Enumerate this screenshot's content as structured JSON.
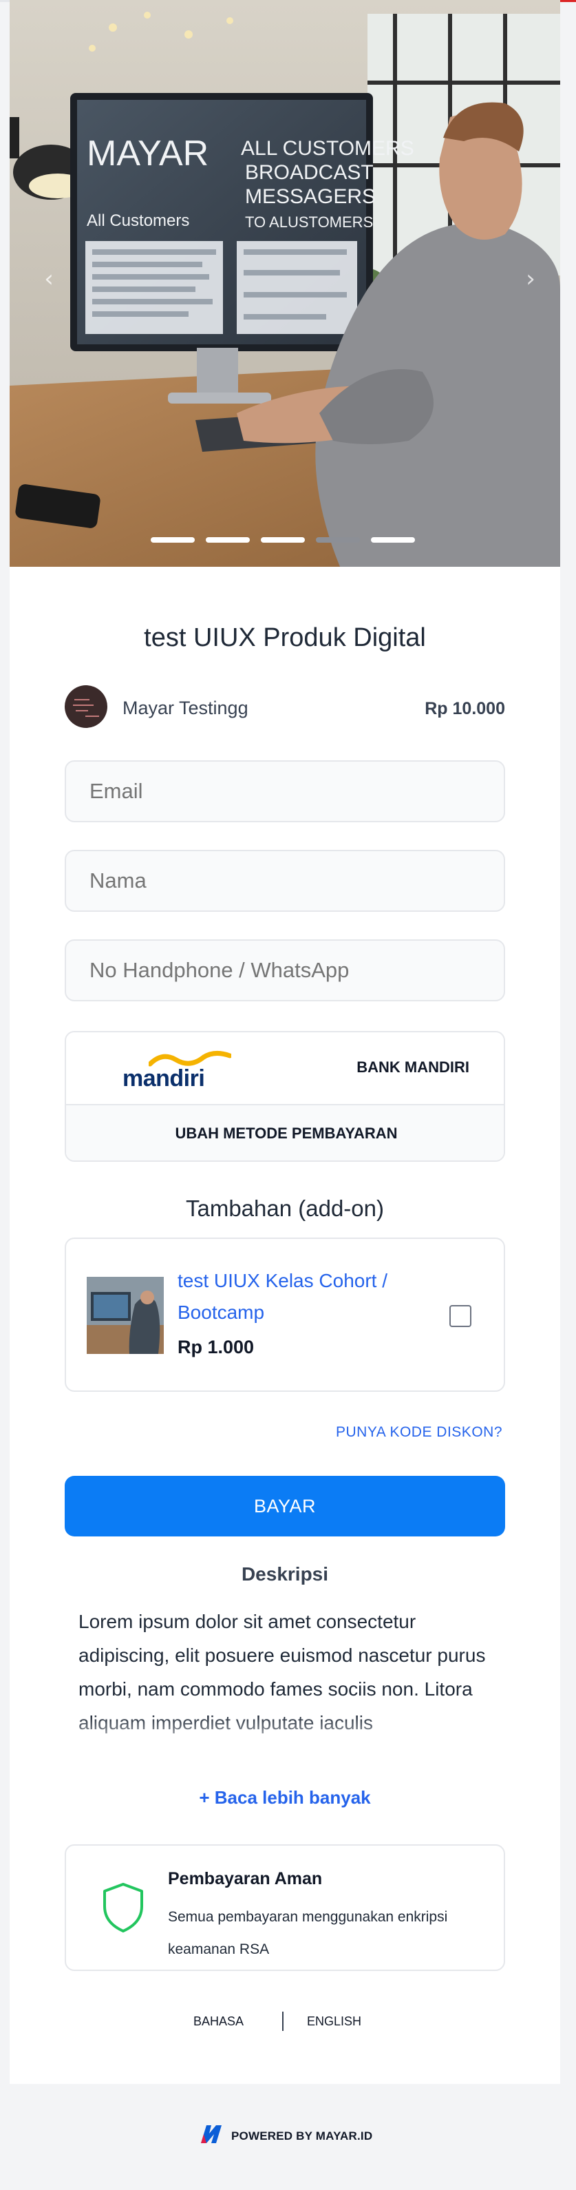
{
  "hero": {
    "monitor_brand": "MAYAR",
    "monitor_left_text": "All Customers",
    "monitor_right_text": [
      "ALL CUSTOMERS",
      "BROADCAST",
      "MESSAGERS",
      "TO ALUSTOMERS"
    ],
    "slides": 5,
    "active_slide": 4
  },
  "product": {
    "title": "test UIUX Produk Digital",
    "seller": "Mayar Testingg",
    "price": "Rp 10.000"
  },
  "form": {
    "email_placeholder": "Email",
    "name_placeholder": "Nama",
    "phone_placeholder": "No Handphone / WhatsApp"
  },
  "payment": {
    "bank_logo_text": "mandiri",
    "bank_name": "BANK MANDIRI",
    "change_label": "UBAH METODE PEMBAYARAN"
  },
  "addon": {
    "section_title": "Tambahan (add-on)",
    "name": "test UIUX Kelas Cohort / Bootcamp",
    "price": "Rp 1.000",
    "checked": false
  },
  "discount_link": "PUNYA KODE DISKON?",
  "pay_button": "BAYAR",
  "description": {
    "title": "Deskripsi",
    "body": "Lorem ipsum dolor sit amet consectetur adipiscing, elit posuere euismod nascetur purus morbi, nam commodo fames sociis non. Litora aliquam imperdiet vulputate iaculis",
    "read_more": "+ Baca lebih banyak"
  },
  "secure": {
    "title": "Pembayaran Aman",
    "text": "Semua pembayaran menggunakan enkripsi keamanan RSA"
  },
  "language": {
    "bahasa": "BAHASA",
    "english": "ENGLISH"
  },
  "footer": {
    "powered": "POWERED BY MAYAR.ID"
  },
  "colors": {
    "accent": "#0b7cf5",
    "link": "#2563eb",
    "shield": "#22c55e"
  }
}
